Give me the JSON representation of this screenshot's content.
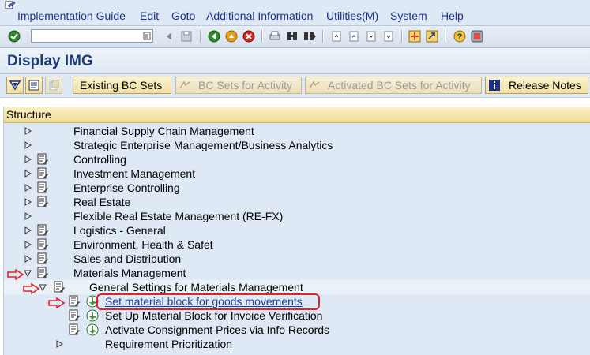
{
  "menu": {
    "items": [
      "Implementation Guide",
      "Edit",
      "Goto",
      "Additional Information",
      "Utilities(M)",
      "System",
      "Help"
    ]
  },
  "title": "Display IMG",
  "app_toolbar": {
    "existing_bc_sets": "Existing BC Sets",
    "bc_sets_for_activity": "BC Sets for Activity",
    "activated_bc_sets": "Activated BC Sets for Activity",
    "release_notes": "Release Notes"
  },
  "tree": {
    "header": "Structure",
    "rows": [
      {
        "label": "Financial Supply Chain Management",
        "doc": false
      },
      {
        "label": "Strategic Enterprise Management/Business Analytics",
        "doc": false
      },
      {
        "label": "Controlling",
        "doc": true
      },
      {
        "label": "Investment Management",
        "doc": true
      },
      {
        "label": "Enterprise Controlling",
        "doc": true
      },
      {
        "label": "Real Estate",
        "doc": true
      },
      {
        "label": "Flexible Real Estate Management (RE-FX)",
        "doc": false
      },
      {
        "label": "Logistics - General",
        "doc": true
      },
      {
        "label": "Environment, Health & Safet",
        "doc": true
      },
      {
        "label": "Sales and Distribution",
        "doc": true
      },
      {
        "label": "Materials Management",
        "doc": true,
        "expanded": true
      },
      {
        "label": "General Settings for Materials Management",
        "doc": true,
        "expanded": true
      },
      {
        "label": "Set material block for goods movements",
        "doc": true,
        "activity": true,
        "selected": true
      },
      {
        "label": "Set Up Material Block for Invoice Verification",
        "doc": true,
        "activity": true
      },
      {
        "label": "Activate Consignment Prices via Info Records",
        "doc": true,
        "activity": true
      },
      {
        "label": "Requirement Prioritization",
        "doc": false
      }
    ]
  },
  "colors": {
    "accent_red": "#e3232a",
    "menu_text": "#1b2f8a",
    "title_text": "#1e3e7b"
  }
}
